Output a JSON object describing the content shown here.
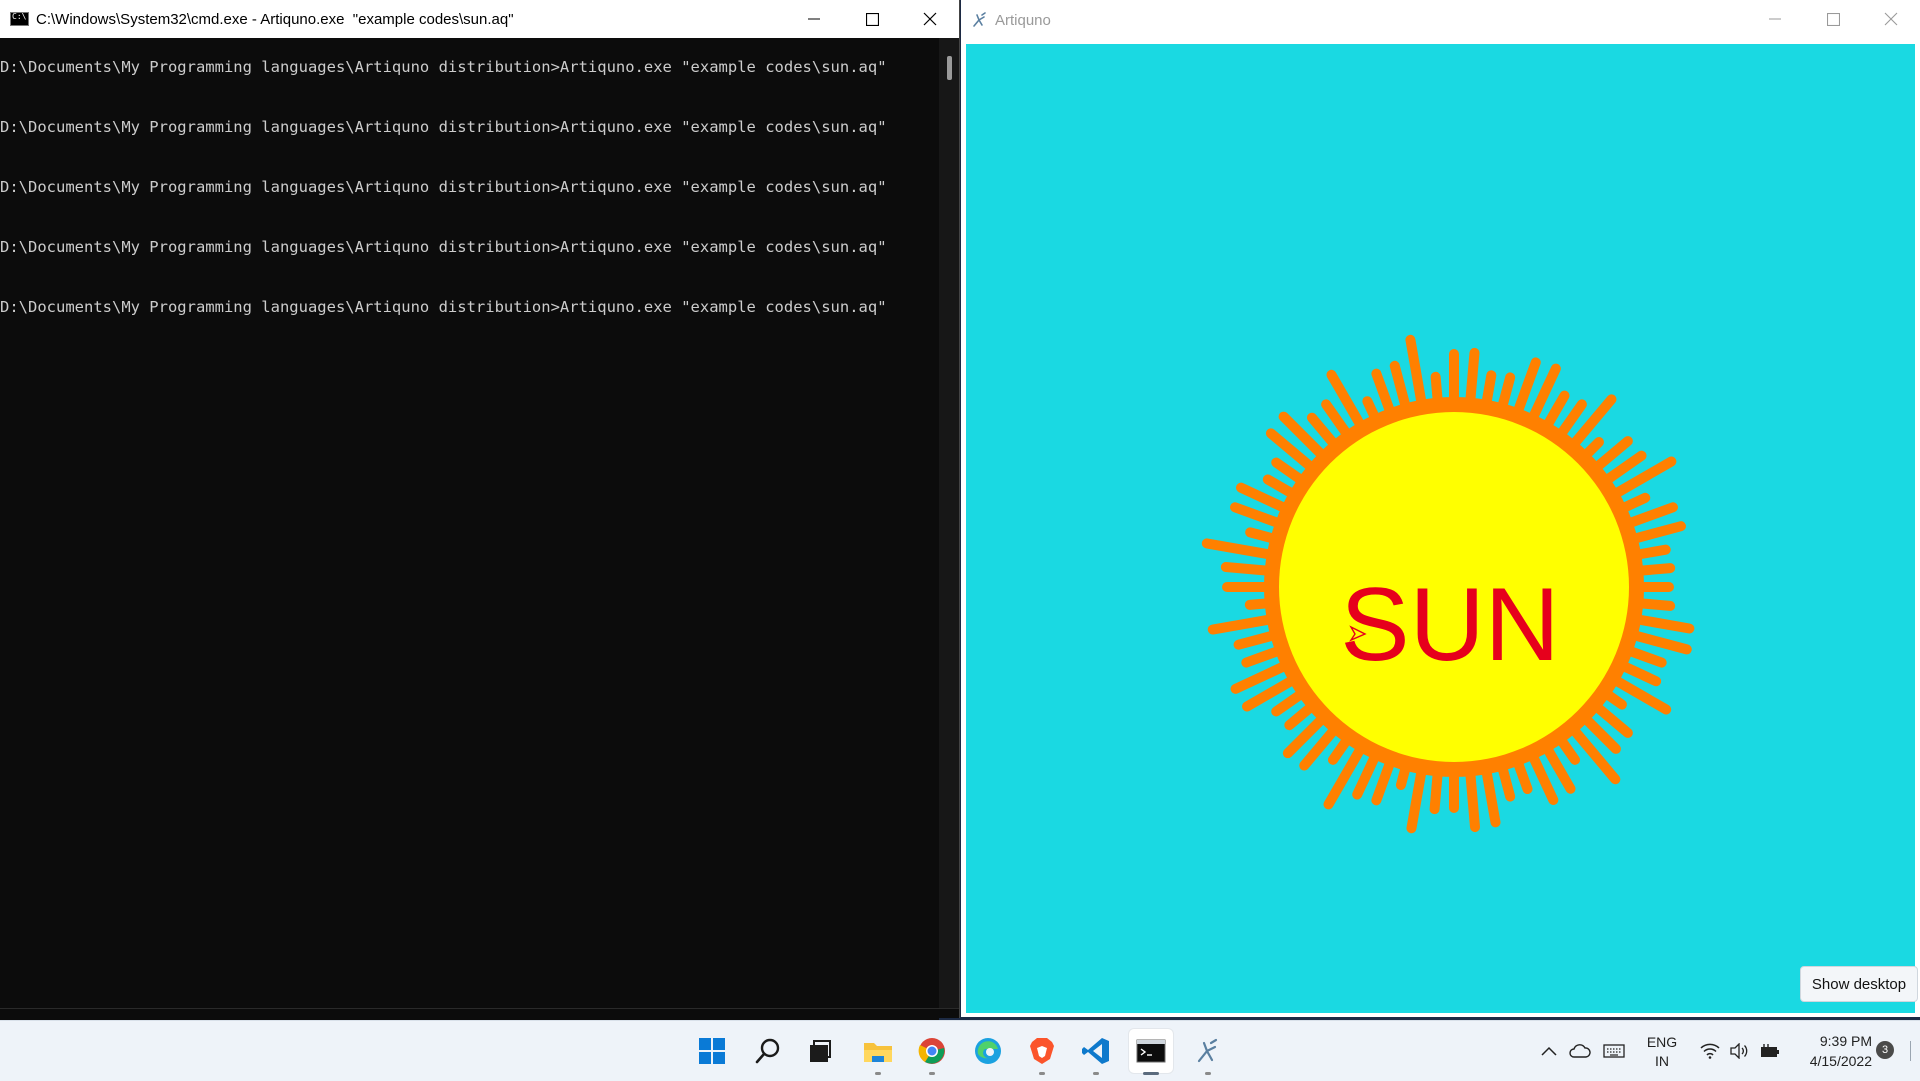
{
  "cmd": {
    "title": "C:\\Windows\\System32\\cmd.exe - Artiquno.exe  \"example codes\\sun.aq\"",
    "lines": [
      "D:\\Documents\\My Programming languages\\Artiquno distribution>Artiquno.exe \"example codes\\sun.aq\"",
      "D:\\Documents\\My Programming languages\\Artiquno distribution>Artiquno.exe \"example codes\\sun.aq\"",
      "D:\\Documents\\My Programming languages\\Artiquno distribution>Artiquno.exe \"example codes\\sun.aq\"",
      "D:\\Documents\\My Programming languages\\Artiquno distribution>Artiquno.exe \"example codes\\sun.aq\"",
      "D:\\Documents\\My Programming languages\\Artiquno distribution>Artiquno.exe \"example codes\\sun.aq\""
    ]
  },
  "artiquno": {
    "title": "Artiquno",
    "sun_text": "SUN",
    "colors": {
      "background": "#1ad9e2",
      "rays": "#ff8000",
      "disk": "#ffff00",
      "text": "#e6001c"
    }
  },
  "show_desktop": "Show desktop",
  "taskbar": {
    "apps": [
      "start-icon",
      "search-icon",
      "task-view-icon",
      "file-explorer-icon",
      "chrome-icon",
      "edge-icon",
      "brave-icon",
      "vscode-icon",
      "terminal-icon",
      "artiquno-icon"
    ],
    "language": "ENG",
    "region": "IN",
    "time": "9:39 PM",
    "date": "4/15/2022",
    "notifications": "3"
  }
}
